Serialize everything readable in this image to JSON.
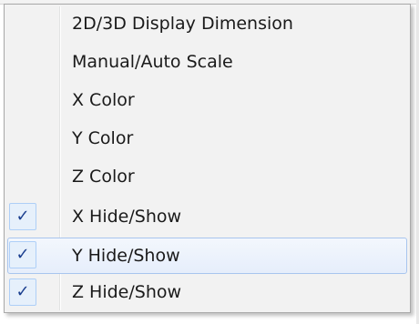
{
  "context_menu": {
    "items": [
      {
        "label": "2D/3D Display Dimension",
        "checked": false,
        "highlighted": false
      },
      {
        "label": "Manual/Auto Scale",
        "checked": false,
        "highlighted": false
      },
      {
        "label": "X Color",
        "checked": false,
        "highlighted": false
      },
      {
        "label": "Y Color",
        "checked": false,
        "highlighted": false
      },
      {
        "label": "Z Color",
        "checked": false,
        "highlighted": false
      },
      {
        "label": "X Hide/Show",
        "checked": true,
        "highlighted": false
      },
      {
        "label": "Y Hide/Show",
        "checked": true,
        "highlighted": true
      },
      {
        "label": "Z Hide/Show",
        "checked": true,
        "highlighted": false
      }
    ],
    "check_glyph": "✓",
    "check_icon": "checkmark-icon",
    "colors": {
      "menu_background": "#f2f2f2",
      "highlight_border": "#a8c5ee",
      "check_color": "#1b3f8f"
    }
  }
}
